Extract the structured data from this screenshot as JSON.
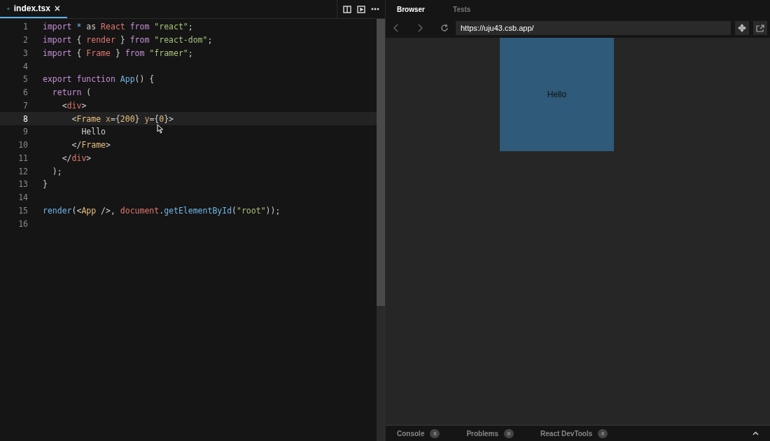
{
  "editor": {
    "tabs": [
      {
        "label": "index.tsx",
        "selected": true,
        "close": "×"
      }
    ],
    "lines": [
      {
        "number": "1",
        "highlighted": false,
        "tokens": [
          {
            "text": "import",
            "kind": "keyword"
          },
          {
            "text": " *",
            "kind": "func"
          },
          {
            "text": " as ",
            "kind": "plain"
          },
          {
            "text": "React",
            "kind": "name"
          },
          {
            "text": " from",
            "kind": "keyword"
          },
          {
            "text": " \"react\"",
            "kind": "string"
          },
          {
            "text": ";",
            "kind": "plain"
          }
        ]
      },
      {
        "number": "2",
        "highlighted": false,
        "tokens": [
          {
            "text": "import",
            "kind": "keyword"
          },
          {
            "text": " { ",
            "kind": "plain"
          },
          {
            "text": "render",
            "kind": "name"
          },
          {
            "text": " } ",
            "kind": "plain"
          },
          {
            "text": "from",
            "kind": "keyword"
          },
          {
            "text": " \"react-dom\"",
            "kind": "string"
          },
          {
            "text": ";",
            "kind": "plain"
          }
        ]
      },
      {
        "number": "3",
        "highlighted": false,
        "tokens": [
          {
            "text": "import",
            "kind": "keyword"
          },
          {
            "text": " { ",
            "kind": "plain"
          },
          {
            "text": "Frame",
            "kind": "name"
          },
          {
            "text": " } ",
            "kind": "plain"
          },
          {
            "text": "from",
            "kind": "keyword"
          },
          {
            "text": " \"framer\"",
            "kind": "string"
          },
          {
            "text": ";",
            "kind": "plain"
          }
        ]
      },
      {
        "number": "4",
        "highlighted": false
      },
      {
        "number": "5",
        "highlighted": false,
        "tokens": [
          {
            "text": "export",
            "kind": "keyword"
          },
          {
            "text": " function",
            "kind": "keyword"
          },
          {
            "text": " App",
            "kind": "func"
          },
          {
            "text": "() {",
            "kind": "plain"
          }
        ]
      },
      {
        "number": "6",
        "highlighted": false,
        "tokens": [
          {
            "text": "  return",
            "kind": "keyword"
          },
          {
            "text": " (",
            "kind": "plain"
          }
        ]
      },
      {
        "number": "7",
        "highlighted": false,
        "tokens": [
          {
            "text": "    <",
            "kind": "plain"
          },
          {
            "text": "div",
            "kind": "name"
          },
          {
            "text": ">",
            "kind": "plain"
          }
        ]
      },
      {
        "number": "8",
        "highlighted": true,
        "tokens": [
          {
            "text": "      <",
            "kind": "plain"
          },
          {
            "text": "Frame",
            "kind": "tag"
          },
          {
            "text": " x",
            "kind": "attr"
          },
          {
            "text": "={",
            "kind": "plain"
          },
          {
            "text": "200",
            "kind": "tag"
          },
          {
            "text": "} ",
            "kind": "plain"
          },
          {
            "text": "y",
            "kind": "attr"
          },
          {
            "text": "={",
            "kind": "plain"
          },
          {
            "text": "0",
            "kind": "tag"
          },
          {
            "text": "}>",
            "kind": "plain"
          }
        ]
      },
      {
        "number": "9",
        "highlighted": false,
        "tokens": [
          {
            "text": "        Hello",
            "kind": "plain"
          }
        ]
      },
      {
        "number": "10",
        "highlighted": false,
        "tokens": [
          {
            "text": "      </",
            "kind": "plain"
          },
          {
            "text": "Frame",
            "kind": "tag"
          },
          {
            "text": ">",
            "kind": "plain"
          }
        ]
      },
      {
        "number": "11",
        "highlighted": false,
        "tokens": [
          {
            "text": "    </",
            "kind": "plain"
          },
          {
            "text": "div",
            "kind": "name"
          },
          {
            "text": ">",
            "kind": "plain"
          }
        ]
      },
      {
        "number": "12",
        "highlighted": false,
        "tokens": [
          {
            "text": "  );",
            "kind": "plain"
          }
        ]
      },
      {
        "number": "13",
        "highlighted": false,
        "tokens": [
          {
            "text": "}",
            "kind": "plain"
          }
        ]
      },
      {
        "number": "14",
        "highlighted": false
      },
      {
        "number": "15",
        "highlighted": false,
        "tokens": [
          {
            "text": "render",
            "kind": "func"
          },
          {
            "text": "(<",
            "kind": "plain"
          },
          {
            "text": "App",
            "kind": "tag"
          },
          {
            "text": " />, ",
            "kind": "plain"
          },
          {
            "text": "document",
            "kind": "name"
          },
          {
            "text": ".",
            "kind": "plain"
          },
          {
            "text": "getElementById",
            "kind": "func"
          },
          {
            "text": "(",
            "kind": "plain"
          },
          {
            "text": "\"root\"",
            "kind": "string"
          },
          {
            "text": "));",
            "kind": "plain"
          }
        ]
      },
      {
        "number": "16",
        "highlighted": false
      }
    ]
  },
  "preview": {
    "tabs": [
      {
        "label": "Browser",
        "selected": true
      },
      {
        "label": "Tests",
        "selected": false
      }
    ],
    "address": "https://uju43.csb.app/",
    "frame_text": "Hello",
    "bottom_tabs": [
      {
        "label": "Console",
        "count": "0"
      },
      {
        "label": "Problems",
        "count": "0"
      },
      {
        "label": "React DevTools",
        "count": "0"
      }
    ]
  }
}
